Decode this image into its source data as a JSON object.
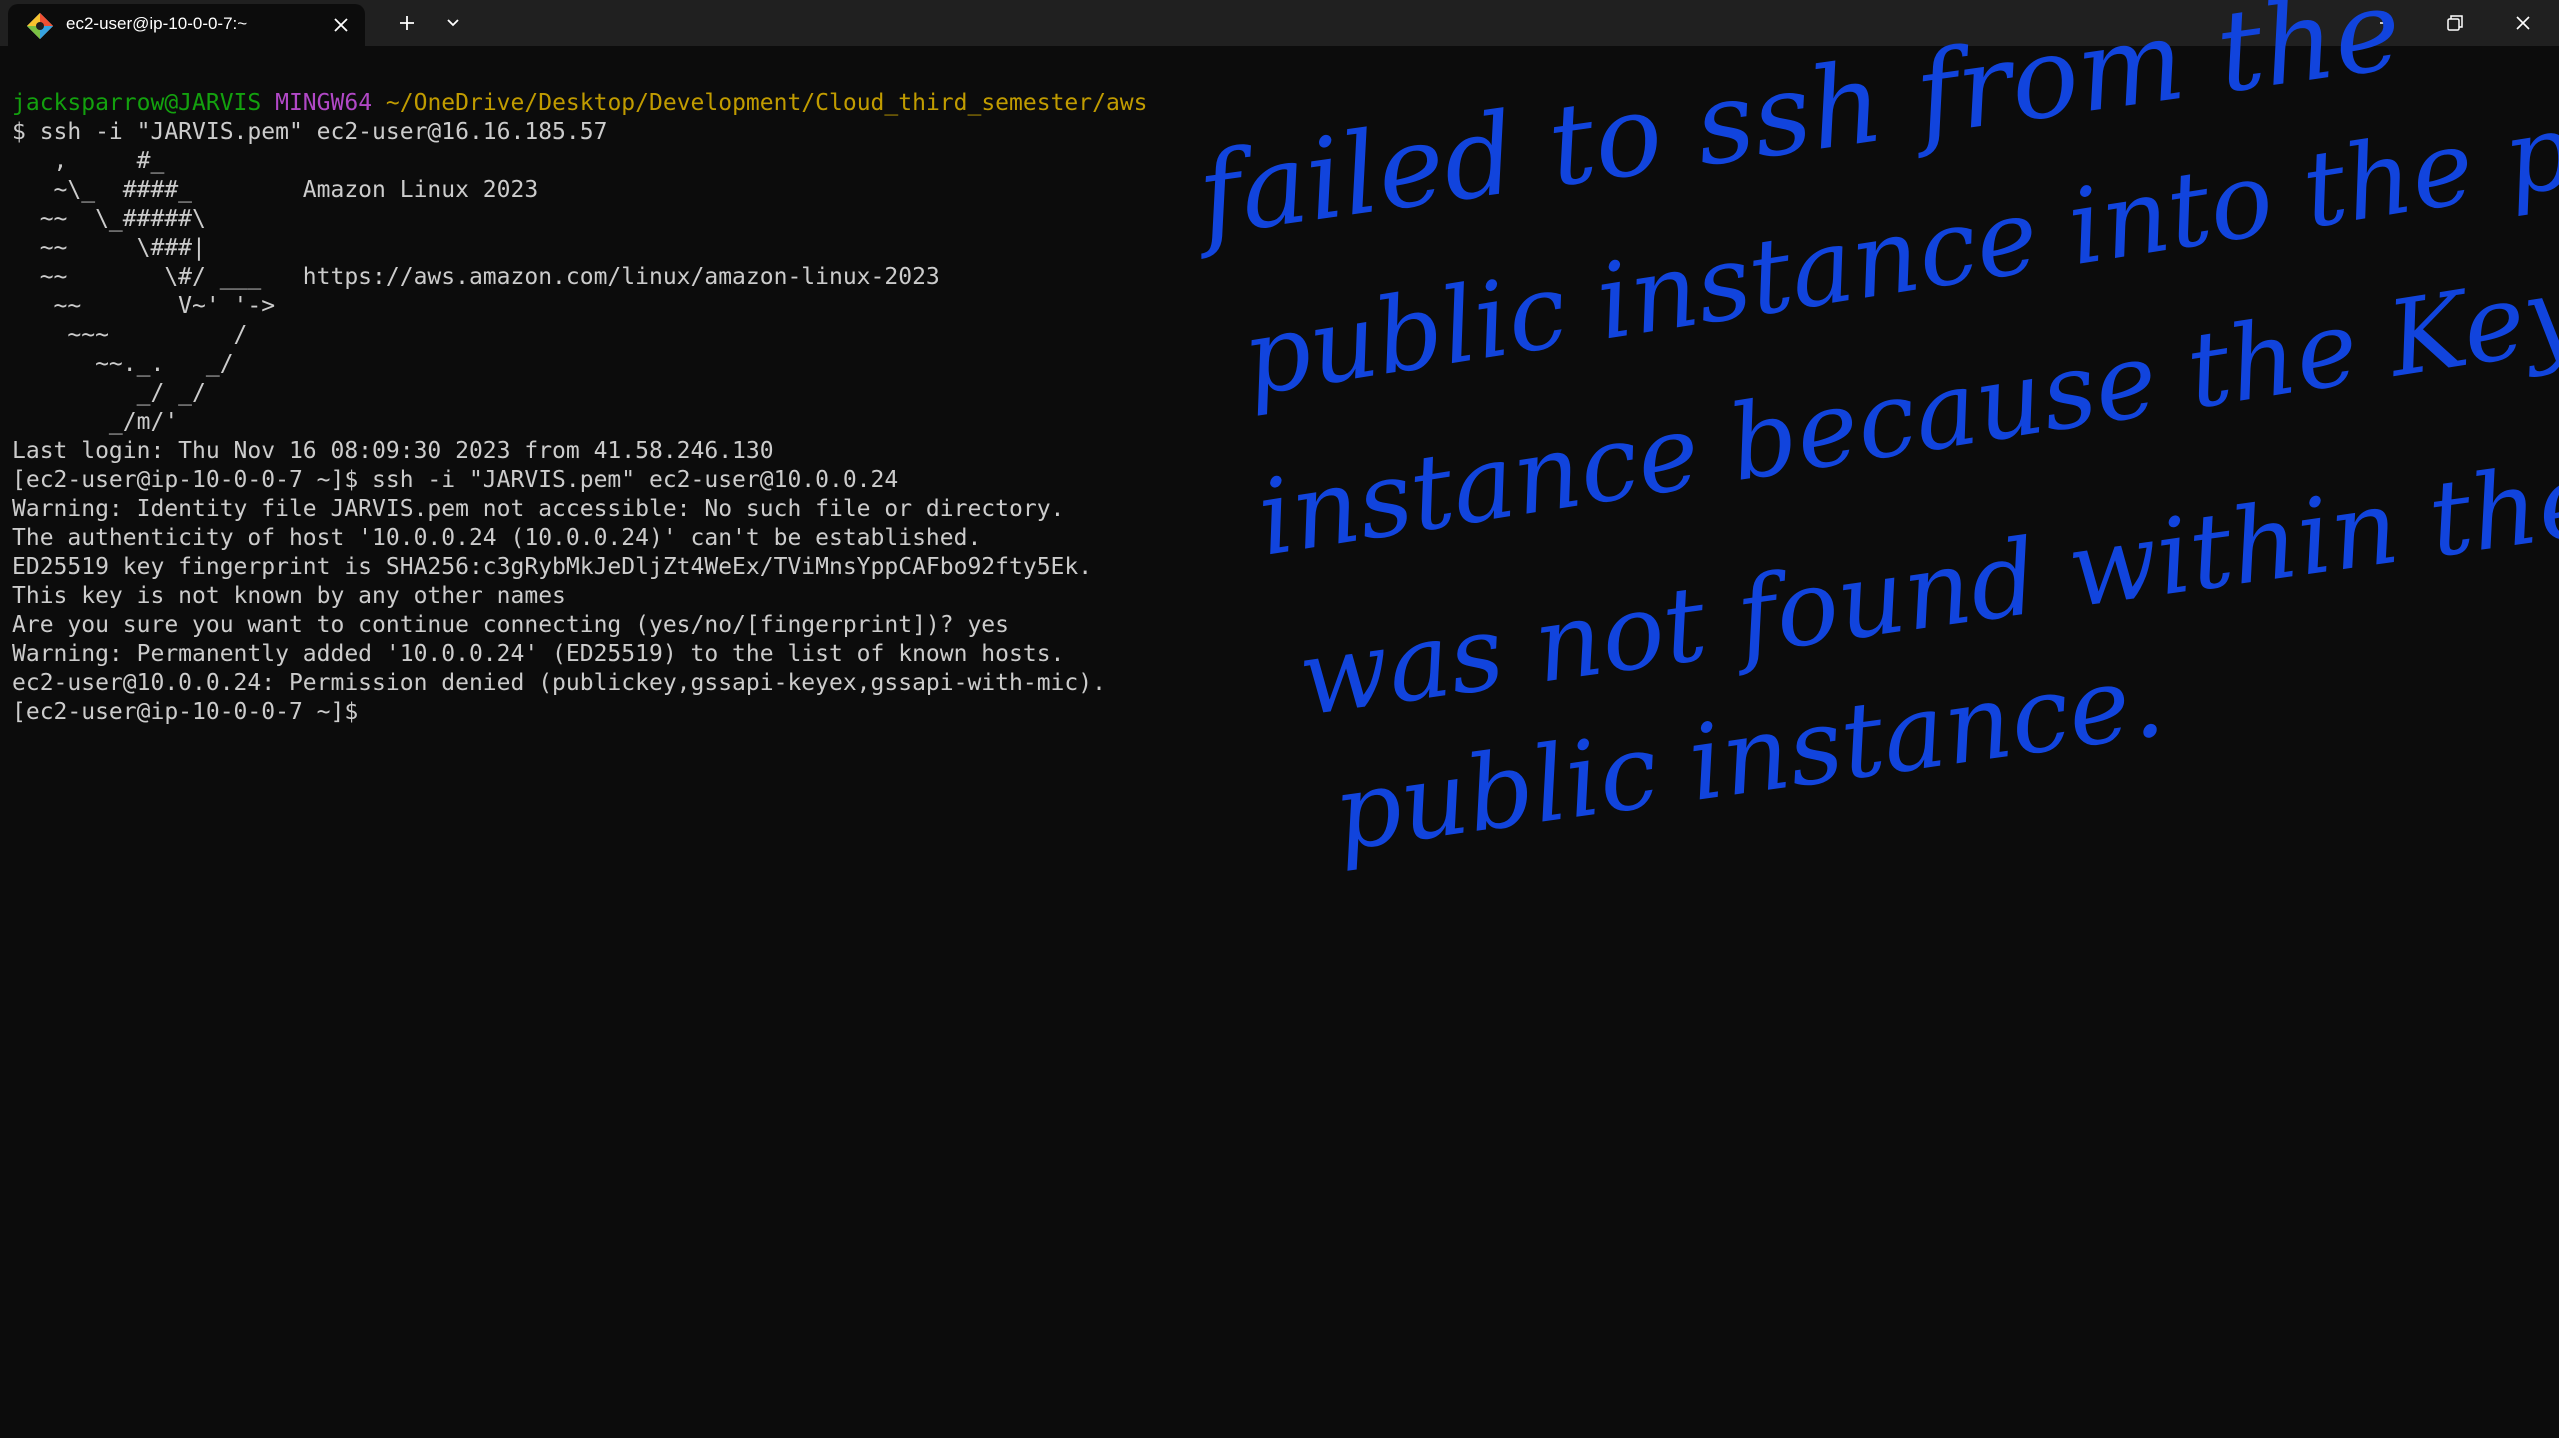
{
  "window": {
    "tab_title": "ec2-user@ip-10-0-0-7:~",
    "icons": {
      "app": "git-bash-icon",
      "tab_close": "close-icon",
      "new_tab": "plus-icon",
      "dropdown": "chevron-down-icon",
      "minimize": "minimize-icon",
      "maximize": "restore-icon",
      "close": "close-icon"
    }
  },
  "terminal": {
    "prompt": {
      "user_host": "jacksparrow@JARVIS",
      "env": "MINGW64",
      "path": "~/OneDrive/Desktop/Development/Cloud_third_semester/aws"
    },
    "lines": [
      "$ ssh -i \"JARVIS.pem\" ec2-user@16.16.185.57",
      "   ,     #_",
      "   ~\\_  ####_        Amazon Linux 2023",
      "  ~~  \\_#####\\",
      "  ~~     \\###|",
      "  ~~       \\#/ ___   https://aws.amazon.com/linux/amazon-linux-2023",
      "   ~~       V~' '->",
      "    ~~~         /",
      "      ~~._.   _/",
      "         _/ _/",
      "       _/m/'",
      "Last login: Thu Nov 16 08:09:30 2023 from 41.58.246.130",
      "[ec2-user@ip-10-0-0-7 ~]$ ssh -i \"JARVIS.pem\" ec2-user@10.0.0.24",
      "Warning: Identity file JARVIS.pem not accessible: No such file or directory.",
      "The authenticity of host '10.0.0.24 (10.0.0.24)' can't be established.",
      "ED25519 key fingerprint is SHA256:c3gRybMkJeDljZt4WeEx/TViMnsYppCAFbo92fty5Ek.",
      "This key is not known by any other names",
      "Are you sure you want to continue connecting (yes/no/[fingerprint])? yes",
      "Warning: Permanently added '10.0.0.24' (ED25519) to the list of known hosts.",
      "ec2-user@10.0.0.24: Permission denied (publickey,gssapi-keyex,gssapi-with-mic).",
      "[ec2-user@ip-10-0-0-7 ~]$"
    ],
    "colors": {
      "background": "#0c0c0c",
      "text": "#cccccc",
      "user_host": "#13a10e",
      "env": "#b148c6",
      "path": "#c19c00"
    }
  },
  "annotation": {
    "lines": [
      "failed to ssh from the",
      "public instance into the private",
      "instance because the Keypair",
      "was not found within the",
      "public instance."
    ],
    "color": "#1144dd"
  }
}
